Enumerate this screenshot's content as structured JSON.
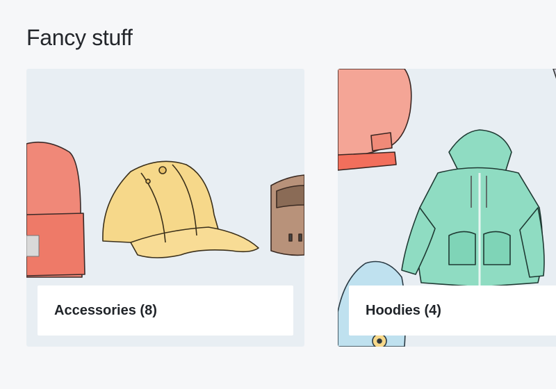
{
  "section": {
    "title": "Fancy stuff"
  },
  "categories": [
    {
      "name": "Accessories",
      "count": "8",
      "label": "Accessories (8)"
    },
    {
      "name": "Hoodies",
      "count": "4",
      "label": "Hoodies (4)"
    }
  ],
  "colors": {
    "page_bg": "#f6f7f9",
    "card_bg": "#e8eef3",
    "beanie": "#f08878",
    "cap": "#f6d88a",
    "belt": "#b8927a",
    "hoodie_green": "#8fdcc2",
    "hoodie_pink": "#f4a596",
    "hoodie_blue": "#bfe1ef"
  }
}
